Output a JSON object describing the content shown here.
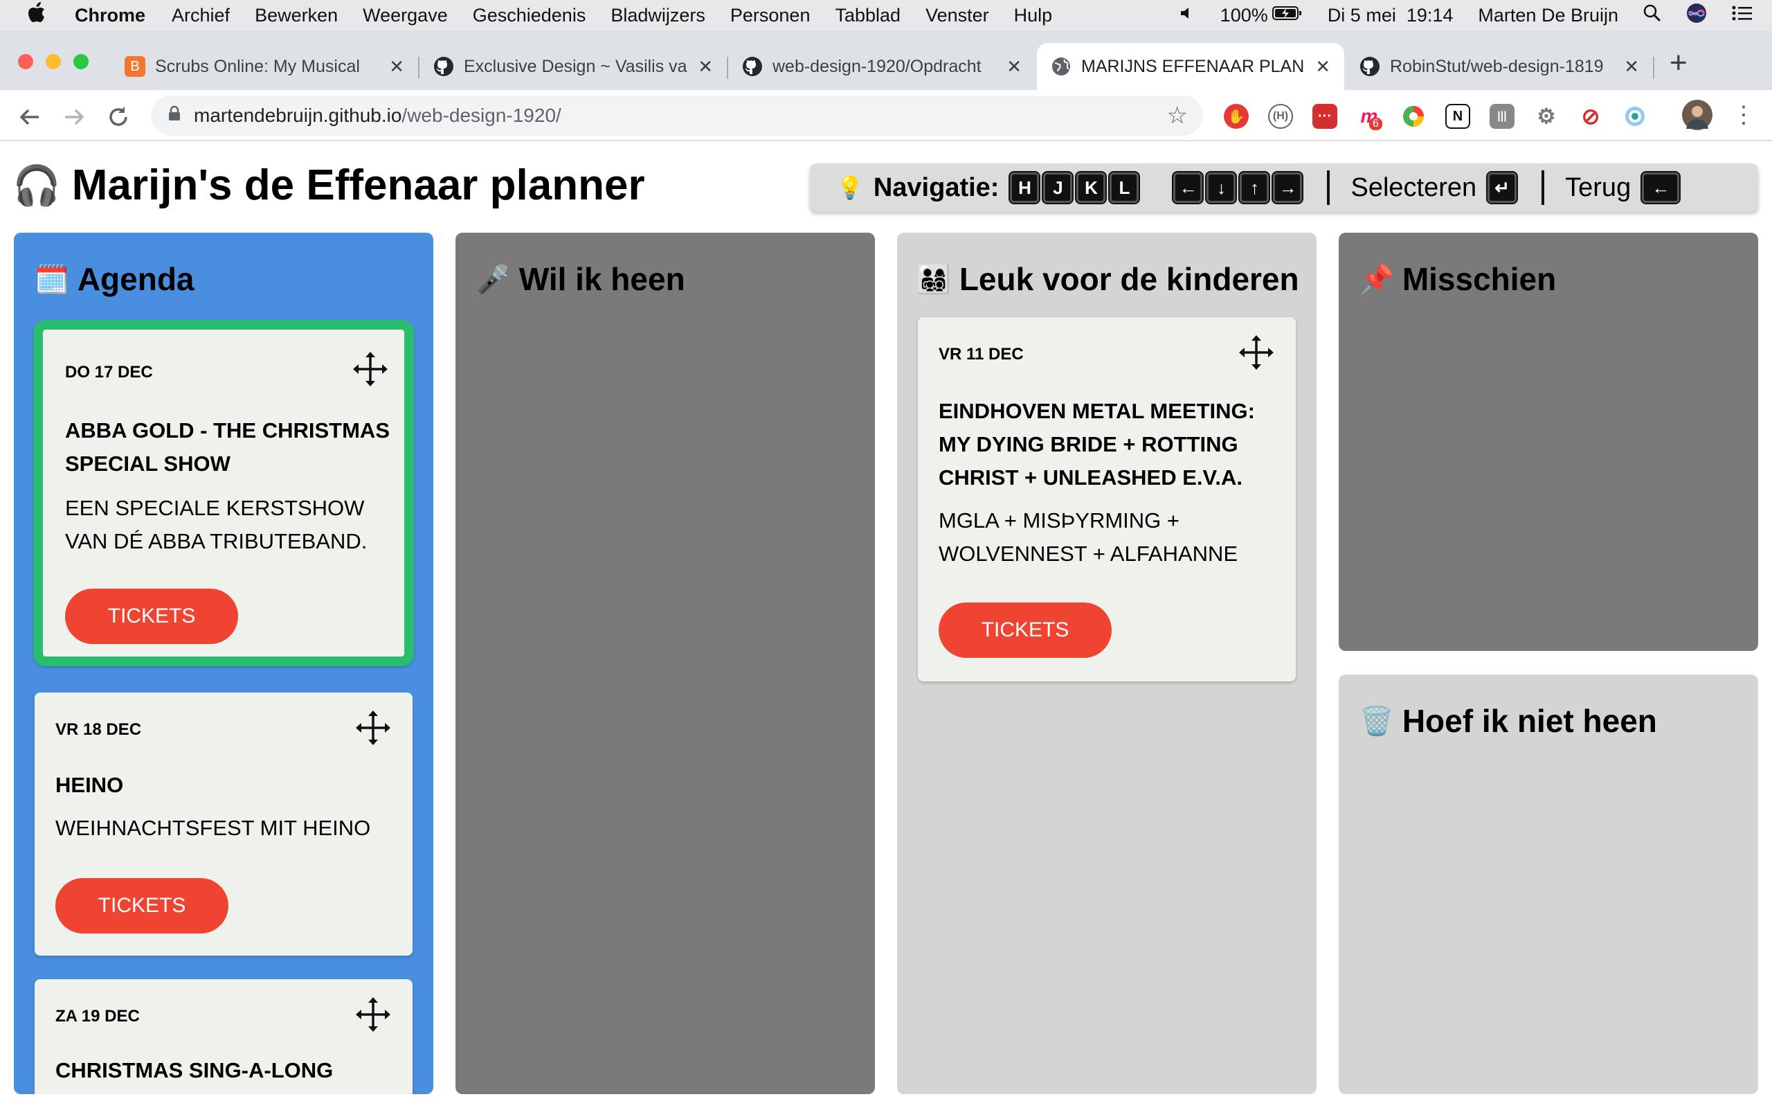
{
  "menubar": {
    "apple": "",
    "app_name": "Chrome",
    "items": [
      "Archief",
      "Bewerken",
      "Weergave",
      "Geschiedenis",
      "Bladwijzers",
      "Personen",
      "Tabblad",
      "Venster",
      "Hulp"
    ],
    "volume_icon": "speaker-icon",
    "battery": "100%",
    "date_time": "Di 5 mei  19:14",
    "user": "Marten De Bruijn"
  },
  "tabs": [
    {
      "title": "Scrubs Online: My Musical",
      "icon": "blogger-icon",
      "color": "#f4772f"
    },
    {
      "title": "Exclusive Design ~ Vasilis va",
      "icon": "github-icon",
      "color": "#24292e"
    },
    {
      "title": "web-design-1920/Opdracht",
      "icon": "github-icon",
      "color": "#24292e"
    },
    {
      "title": "MARIJNS EFFENAAR PLANN",
      "icon": "globe-icon",
      "color": "#5f6368"
    },
    {
      "title": "RobinStut/web-design-1819",
      "icon": "github-icon",
      "color": "#24292e"
    }
  ],
  "active_tab": 3,
  "toolbar": {
    "url_host": "martendebruijn.github.io",
    "url_path": "/web-design-1920/"
  },
  "page": {
    "title": "Marijn's de Effenaar planner",
    "title_emoji": "🎧"
  },
  "help": {
    "emoji": "💡",
    "nav_label": "Navigatie:",
    "letter_keys": [
      "H",
      "J",
      "K",
      "L"
    ],
    "arrow_keys": [
      "←",
      "↓",
      "↑",
      "→"
    ],
    "select_label": "Selecteren",
    "select_key": "↵",
    "back_label": "Terug",
    "back_key": "←"
  },
  "columns": {
    "agenda": {
      "emoji": "🗓️",
      "title": "Agenda"
    },
    "wil": {
      "emoji": "🎤",
      "title": "Wil ik heen"
    },
    "leuk": {
      "emoji": "👨‍👩‍👧‍👦",
      "title": "Leuk voor de kinderen"
    },
    "misschien": {
      "emoji": "📌",
      "title": "Misschien"
    },
    "hoef": {
      "emoji": "🗑️",
      "title": "Hoef ik niet heen"
    }
  },
  "cards": {
    "abba": {
      "date": "DO 17 DEC",
      "title_lines": [
        "ABBA GOLD - THE CHRISTMAS",
        "SPECIAL SHOW"
      ],
      "desc_lines": [
        "EEN SPECIALE KERSTSHOW",
        "VAN DÉ ABBA TRIBUTEBAND."
      ],
      "button": "TICKETS"
    },
    "heino": {
      "date": "VR 18 DEC",
      "title_lines": [
        "HEINO"
      ],
      "desc_lines": [
        "WEIHNACHTSFEST MIT HEINO"
      ],
      "button": "TICKETS"
    },
    "christmas": {
      "date": "ZA 19 DEC",
      "title_lines": [
        "CHRISTMAS SING-A-LONG"
      ]
    },
    "metal": {
      "date": "VR 11 DEC",
      "title_lines": [
        "EINDHOVEN METAL MEETING:",
        "MY DYING BRIDE + ROTTING",
        "CHRIST + UNLEASHED E.V.A."
      ],
      "desc_lines": [
        "MGLA + MISÞYRMING +",
        "WOLVENNEST + ALFAHANNE"
      ],
      "button": "TICKETS"
    }
  },
  "colors": {
    "agenda_bg": "#4a8ee0",
    "dark_column": "#7a7a7a",
    "light_column": "#d4d4d4",
    "card_bg": "#eef1ec",
    "selected_border": "#2bbd6e",
    "ticket_button": "#ef4432"
  }
}
